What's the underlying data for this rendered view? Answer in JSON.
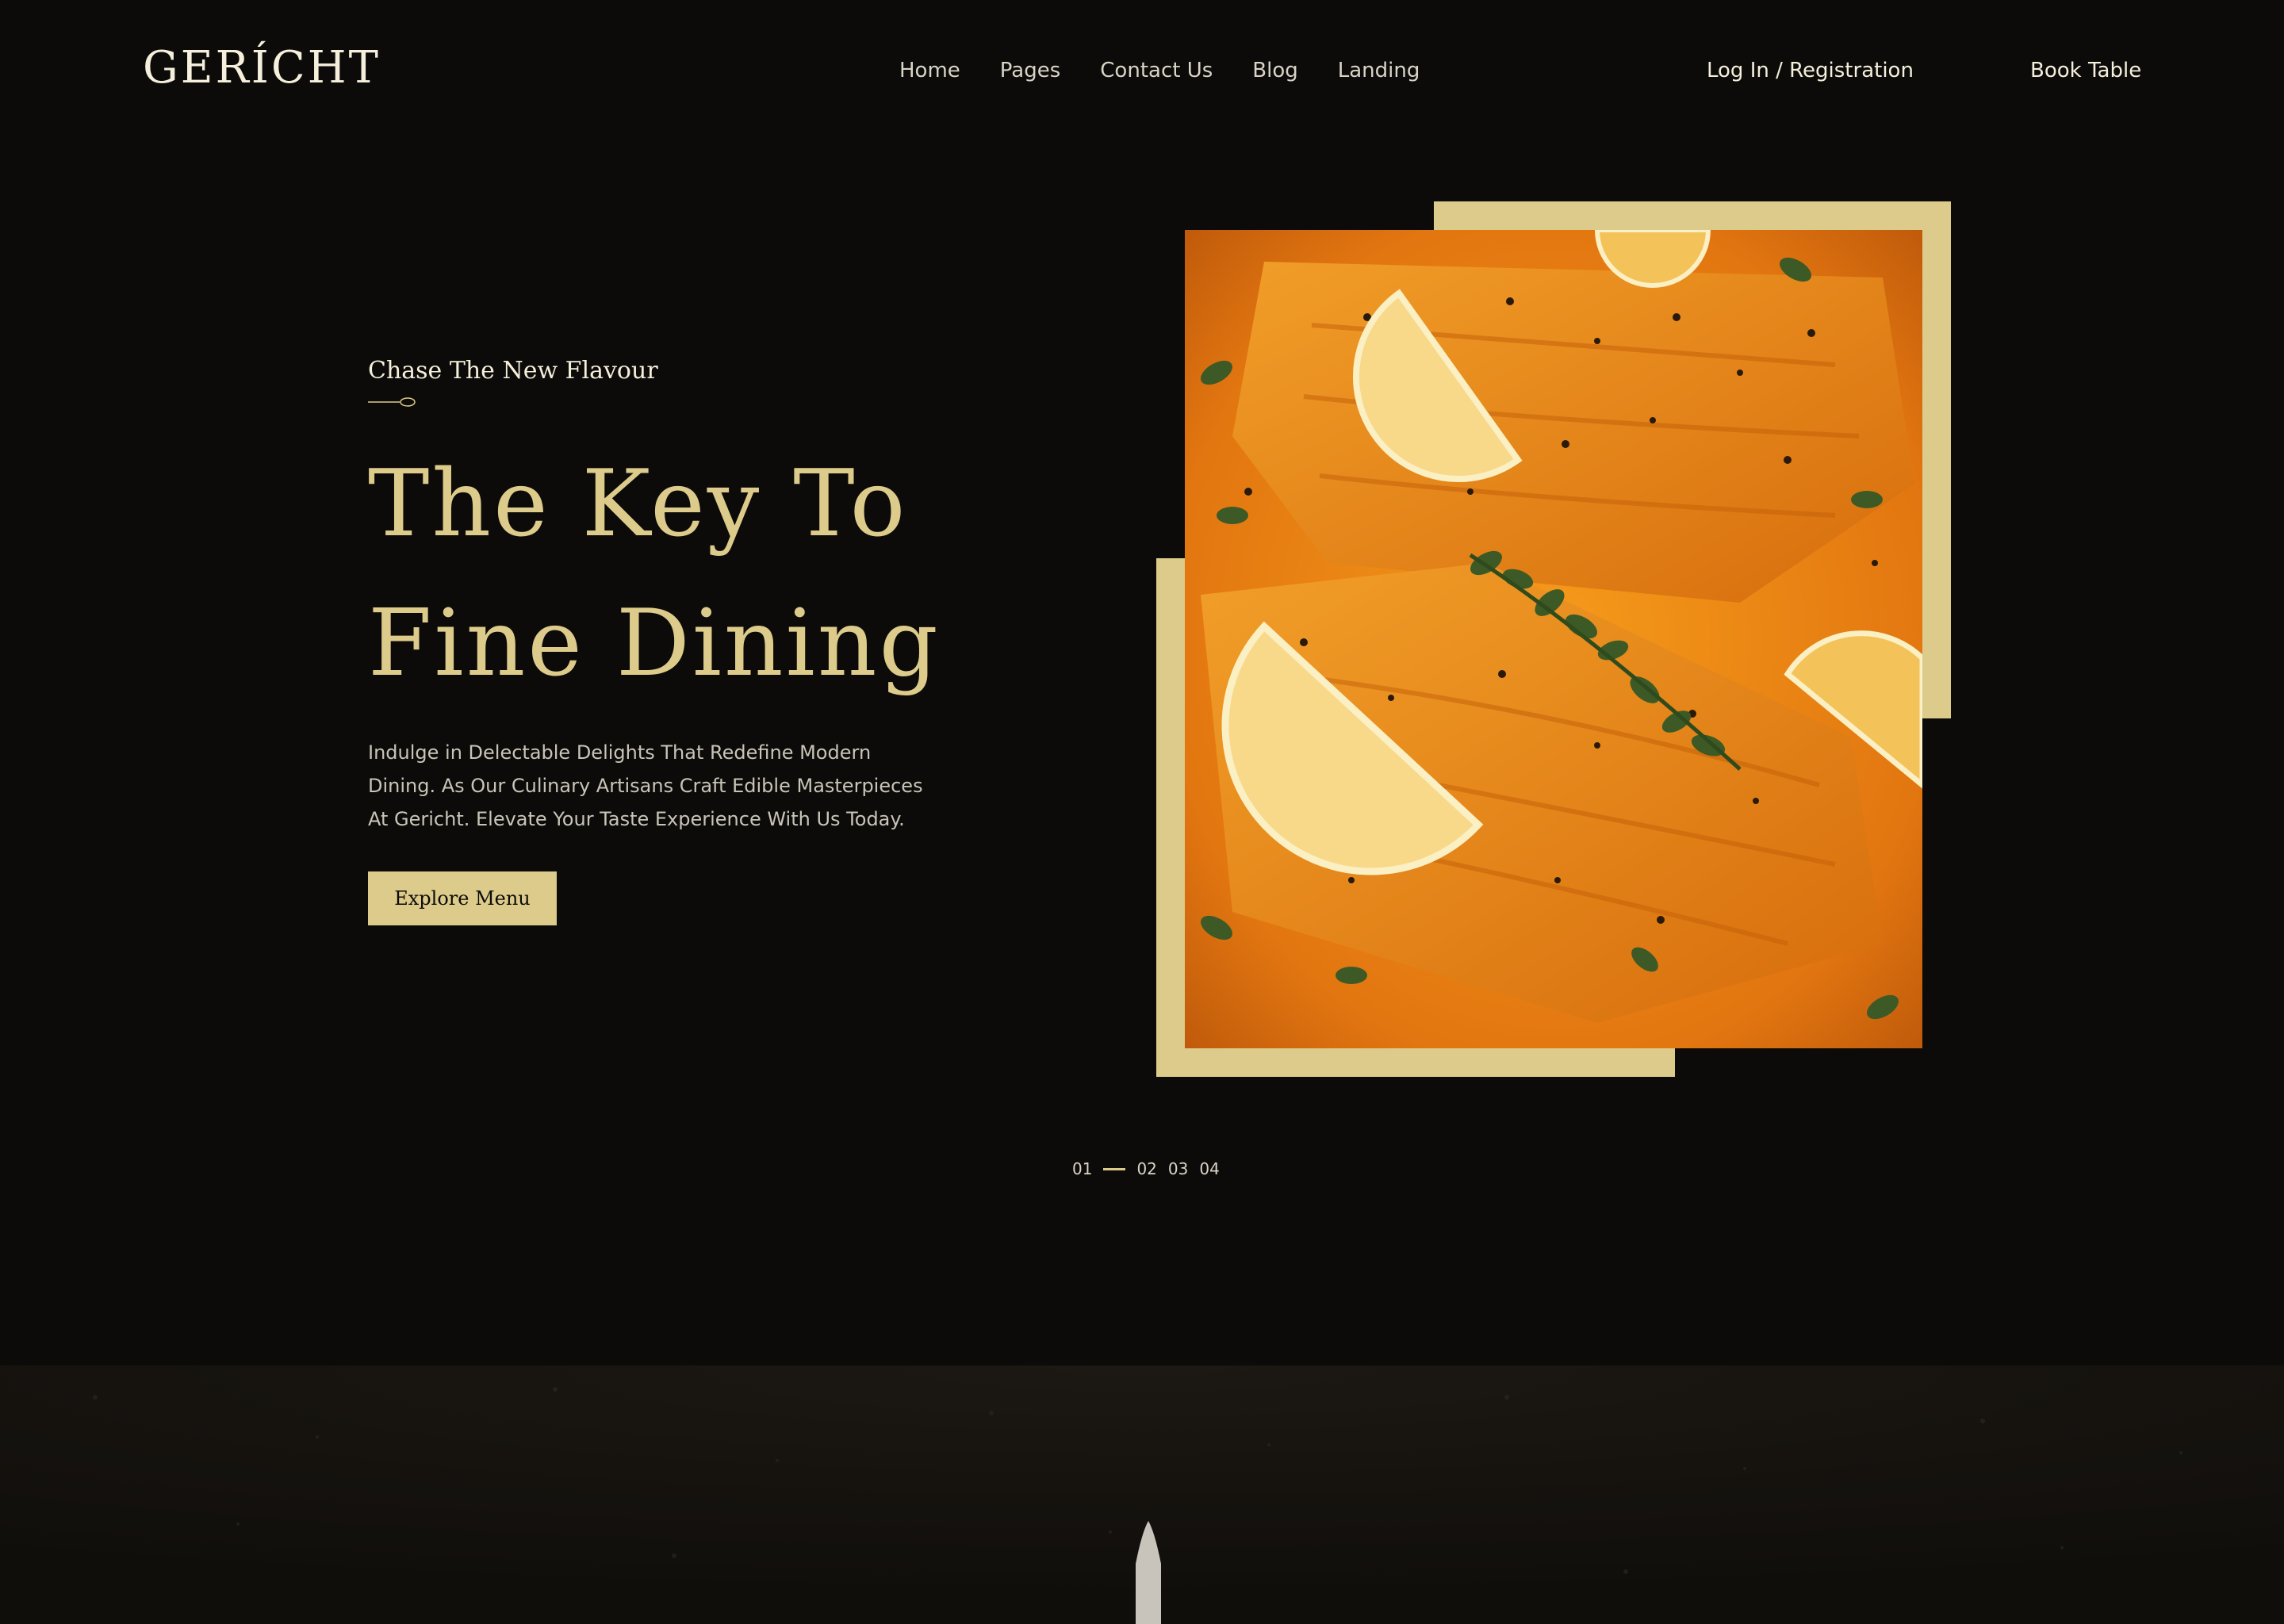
{
  "brand": {
    "logo_text": "GERÍCHT"
  },
  "nav": {
    "links": [
      "Home",
      "Pages",
      "Contact Us",
      "Blog",
      "Landing"
    ],
    "login_label": "Log In / Registration",
    "book_label": "Book Table"
  },
  "hero": {
    "subtitle": "Chase The New Flavour",
    "title_line1": "The Key To",
    "title_line2": "Fine Dining",
    "description_lines": [
      "Indulge in Delectable Delights That Redefine Modern",
      "Dining. As Our Culinary Artisans Craft Edible Masterpieces",
      "At Gericht. Elevate Your Taste Experience With Us Today."
    ],
    "cta_label": "Explore Menu"
  },
  "slider": {
    "items": [
      "01",
      "02",
      "03",
      "04"
    ],
    "active_index": 0
  },
  "colors": {
    "background": "#0c0b09",
    "accent_gold": "#dccb8a",
    "text_light": "#f5efdb"
  },
  "icons": {
    "spoon": "spoon-icon",
    "knife": "knife-icon"
  }
}
